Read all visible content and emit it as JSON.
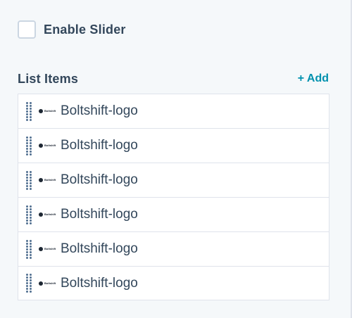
{
  "slider": {
    "label": "Enable Slider",
    "checked": false
  },
  "list": {
    "title": "List Items",
    "add_label": "+ Add",
    "items": [
      {
        "label": "Boltshift-logo",
        "logo_text": "Boltshift"
      },
      {
        "label": "Boltshift-logo",
        "logo_text": "Boltshift"
      },
      {
        "label": "Boltshift-logo",
        "logo_text": "Boltshift"
      },
      {
        "label": "Boltshift-logo",
        "logo_text": "Boltshift"
      },
      {
        "label": "Boltshift-logo",
        "logo_text": "Boltshift"
      },
      {
        "label": "Boltshift-logo",
        "logo_text": "Boltshift"
      }
    ]
  },
  "colors": {
    "accent": "#0091ae",
    "text": "#33475b",
    "border": "#dfe3eb",
    "panel_bg": "#f5f8fa"
  },
  "icons": {
    "drag_handle": "drag-handle-icon",
    "logo": "boltshift-logo-icon"
  }
}
